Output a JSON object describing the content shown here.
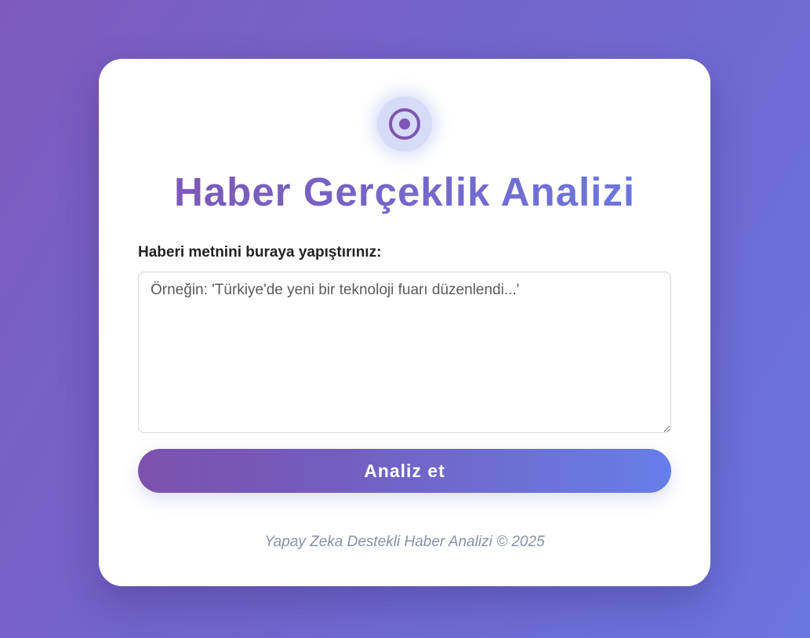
{
  "header": {
    "logo_icon": "target-icon",
    "title": "Haber Gerçeklik Analizi"
  },
  "form": {
    "label": "Haberi metnini buraya yapıştırınız:",
    "textarea_value": "",
    "textarea_placeholder": "Örneğin: 'Türkiye'de yeni bir teknoloji fuarı düzenlendi...'",
    "submit_label": "Analiz et"
  },
  "footer": {
    "text": "Yapay Zeka Destekli Haber Analizi © 2025"
  },
  "colors": {
    "accent_start": "#7e55b3",
    "accent_end": "#667ee9",
    "icon_bg": "#d6dcf7",
    "icon_color": "#7e55b3"
  }
}
